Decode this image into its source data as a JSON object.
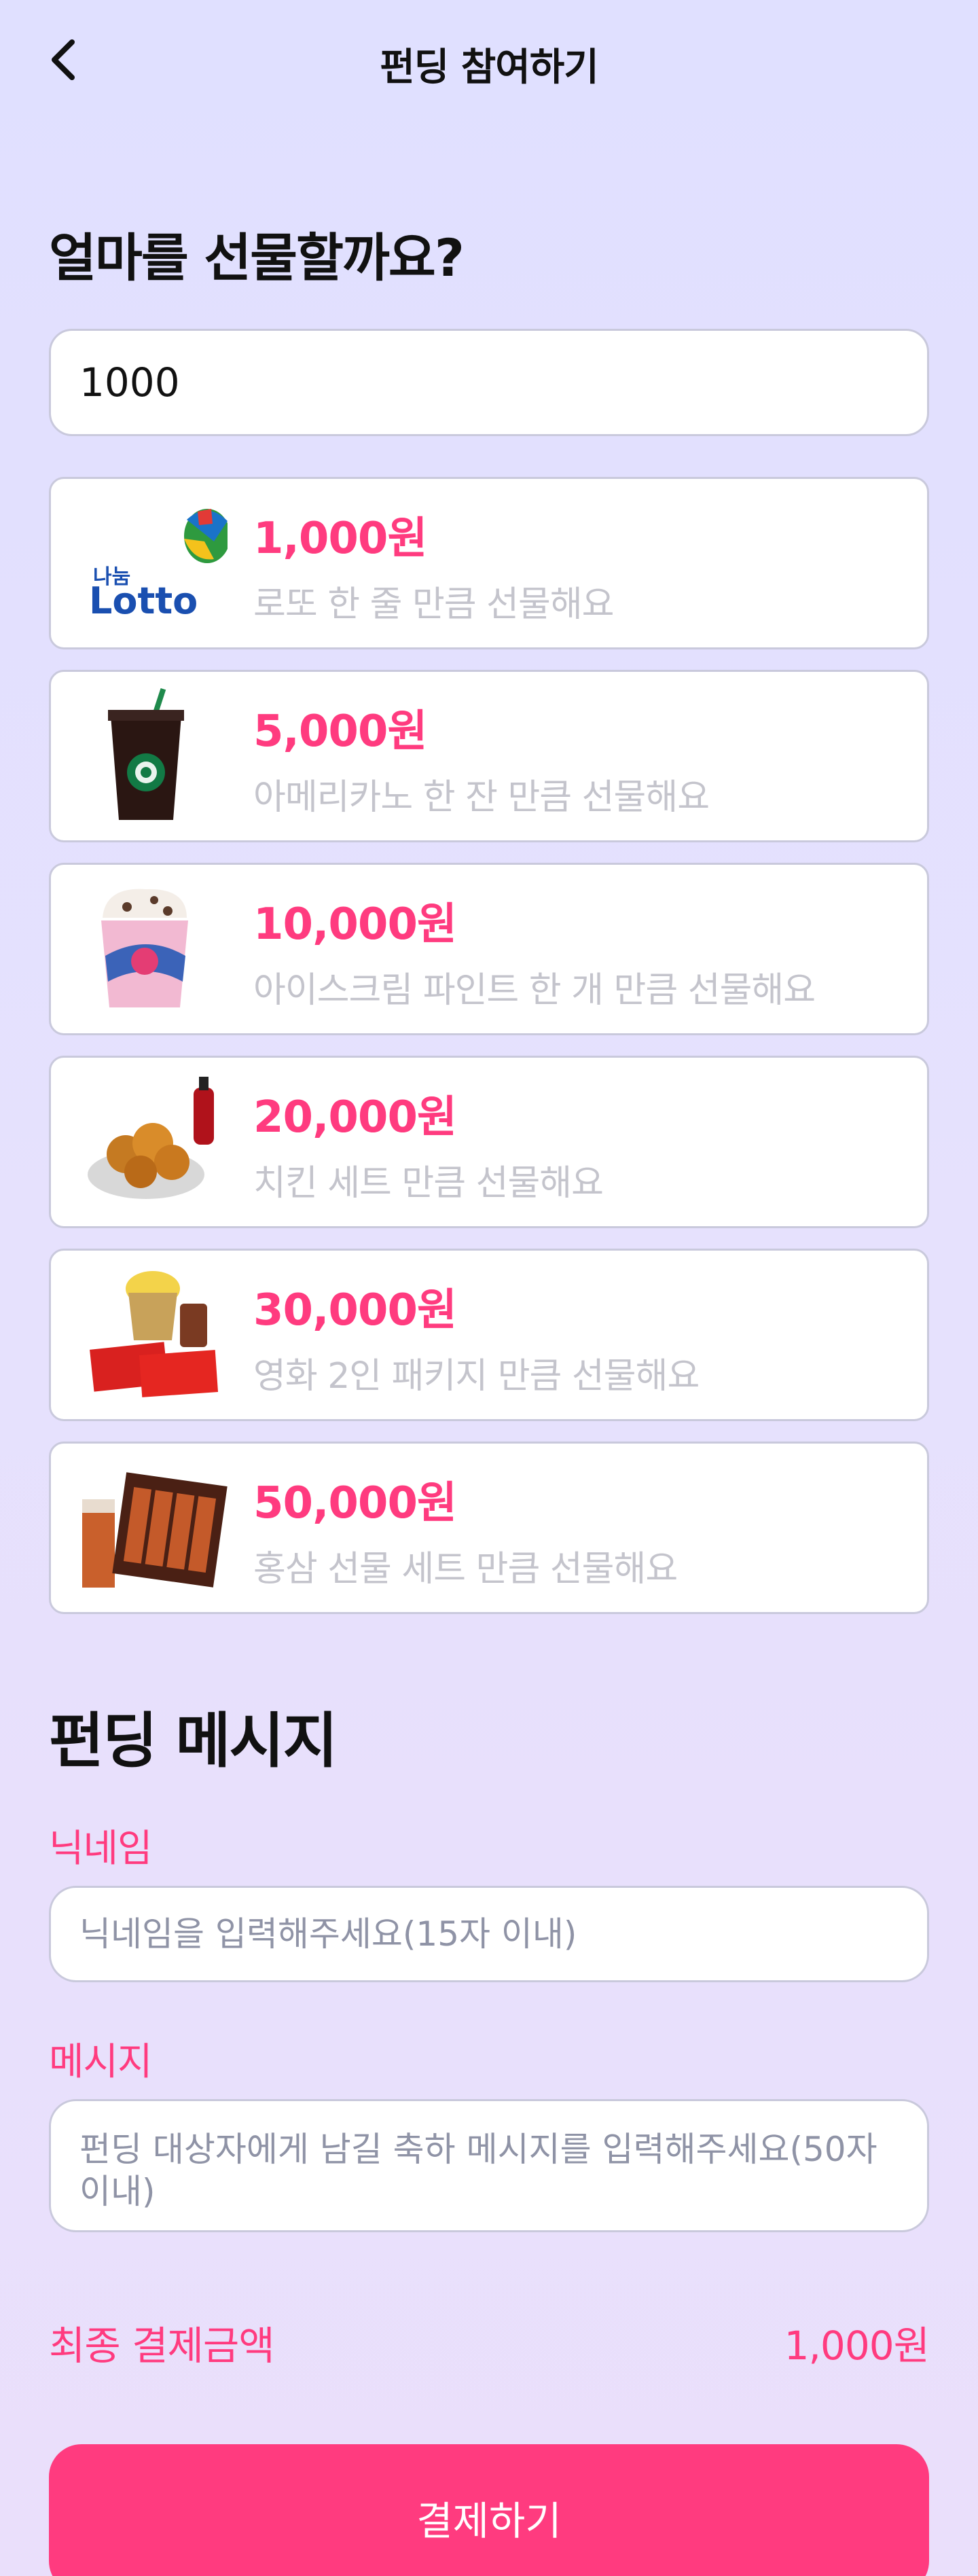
{
  "header": {
    "title": "펀딩 참여하기"
  },
  "amount_section": {
    "title": "얼마를 선물할까요?",
    "input_value": "1000"
  },
  "options": [
    {
      "price": "1,000원",
      "desc": "로또 한 줄 만큼 선물해요",
      "thumb_text": "나눔 Lotto"
    },
    {
      "price": "5,000원",
      "desc": "아메리카노 한 잔 만큼 선물해요"
    },
    {
      "price": "10,000원",
      "desc": "아이스크림 파인트 한 개 만큼 선물해요"
    },
    {
      "price": "20,000원",
      "desc": "치킨 세트 만큼 선물해요"
    },
    {
      "price": "30,000원",
      "desc": "영화 2인 패키지 만큼 선물해요"
    },
    {
      "price": "50,000원",
      "desc": "홍삼 선물 세트 만큼 선물해요"
    }
  ],
  "message_section": {
    "title": "펀딩 메시지",
    "nickname_label": "닉네임",
    "nickname_placeholder": "닉네임을 입력해주세요(15자 이내)",
    "message_label": "메시지",
    "message_placeholder": "펀딩 대상자에게 남길 축하 메시지를 입력해주세요(50자 이내)"
  },
  "total": {
    "label": "최종 결제금액",
    "value": "1,000원"
  },
  "pay_button": "결제하기",
  "colors": {
    "accent": "#ff3b7f",
    "background": "#e2e0ff"
  }
}
